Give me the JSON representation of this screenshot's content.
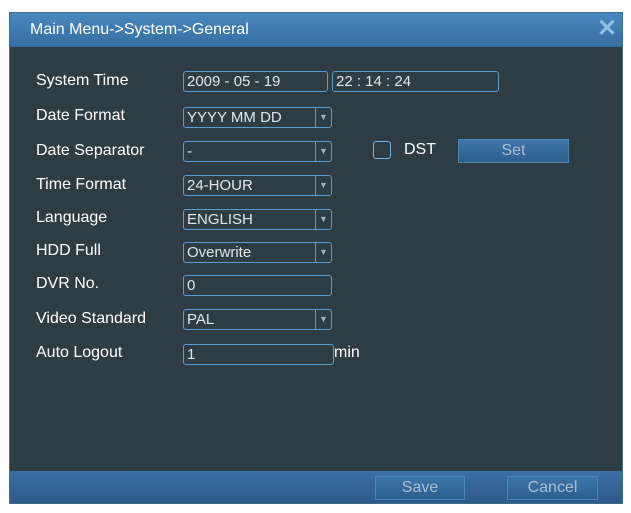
{
  "window": {
    "title": "Main Menu->System->General",
    "close_icon": "close-icon"
  },
  "form": {
    "system_time": {
      "label": "System Time",
      "date": "2009  - 05 -  19",
      "time": "22 :  14 :  24"
    },
    "date_format": {
      "label": "Date Format",
      "value": "YYYY MM DD"
    },
    "date_separator": {
      "label": "Date Separator",
      "value": "-"
    },
    "dst": {
      "label": "DST",
      "checked": false,
      "set_label": "Set"
    },
    "time_format": {
      "label": "Time Format",
      "value": "24-HOUR"
    },
    "language": {
      "label": "Language",
      "value": "ENGLISH"
    },
    "hdd_full": {
      "label": "HDD Full",
      "value": "Overwrite"
    },
    "dvr_no": {
      "label": "DVR No.",
      "value": "0"
    },
    "video_standard": {
      "label": "Video Standard",
      "value": "PAL"
    },
    "auto_logout": {
      "label": "Auto Logout",
      "value": "1",
      "unit": "min"
    }
  },
  "footer": {
    "save_label": "Save",
    "cancel_label": "Cancel"
  },
  "colors": {
    "window_bg": "#2e3d44",
    "title_bar": "#4a88be",
    "field_border": "#5d9ccf",
    "text": "#ffffff"
  }
}
